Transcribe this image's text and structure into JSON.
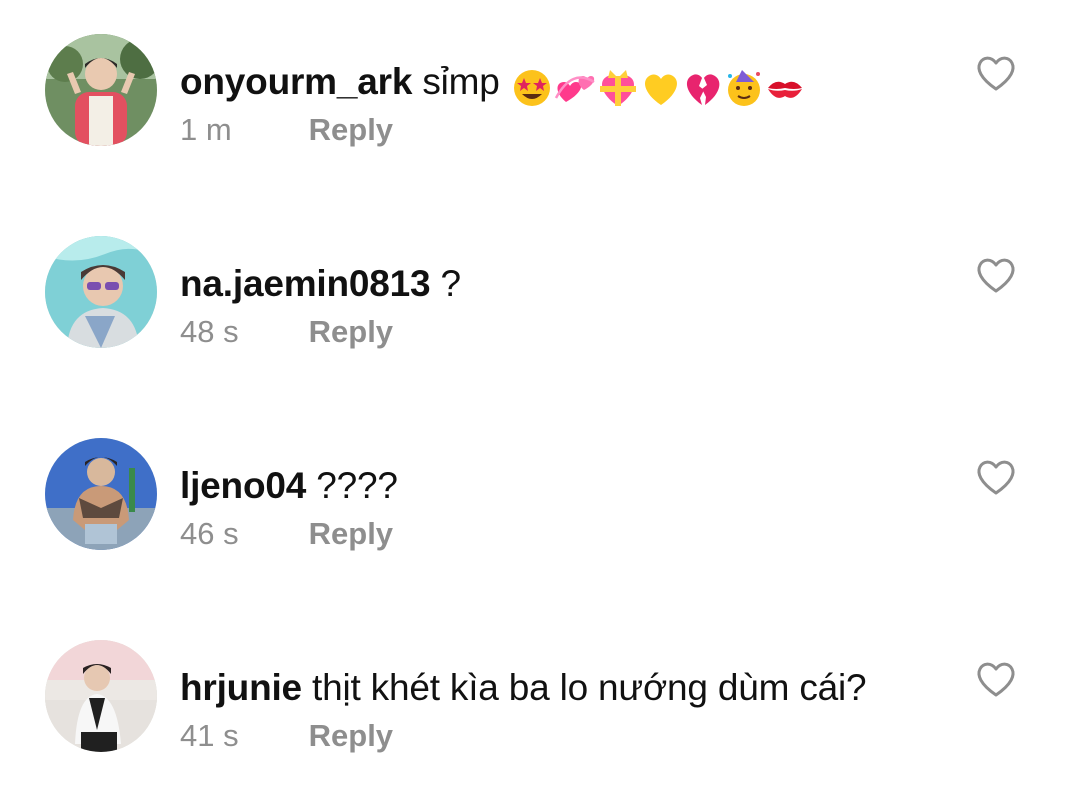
{
  "comments": [
    {
      "username": "onyourm_ark",
      "text": "sỉmp",
      "emojis": [
        "star-struck-emoji",
        "revolving-hearts-emoji",
        "heart-with-ribbon-emoji",
        "yellow-heart-emoji",
        "broken-heart-emoji",
        "partying-face-emoji",
        "kiss-mark-emoji"
      ],
      "time": "1 m",
      "reply_label": "Reply",
      "avatar": "avatar-onyourm-ark"
    },
    {
      "username": "na.jaemin0813",
      "text": "?",
      "time": "48 s",
      "reply_label": "Reply",
      "avatar": "avatar-na-jaemin0813"
    },
    {
      "username": "ljeno04",
      "text": "????",
      "time": "46 s",
      "reply_label": "Reply",
      "avatar": "avatar-ljeno04"
    },
    {
      "username": "hrjunie",
      "text": "thịt khét kìa ba lo nướng dùm cái?",
      "time": "41 s",
      "reply_label": "Reply",
      "avatar": "avatar-hrjunie"
    }
  ],
  "icons": {
    "like": "heart-outline-icon"
  },
  "colors": {
    "text_primary": "#111111",
    "text_secondary": "#8e8e8e",
    "background": "#ffffff"
  }
}
